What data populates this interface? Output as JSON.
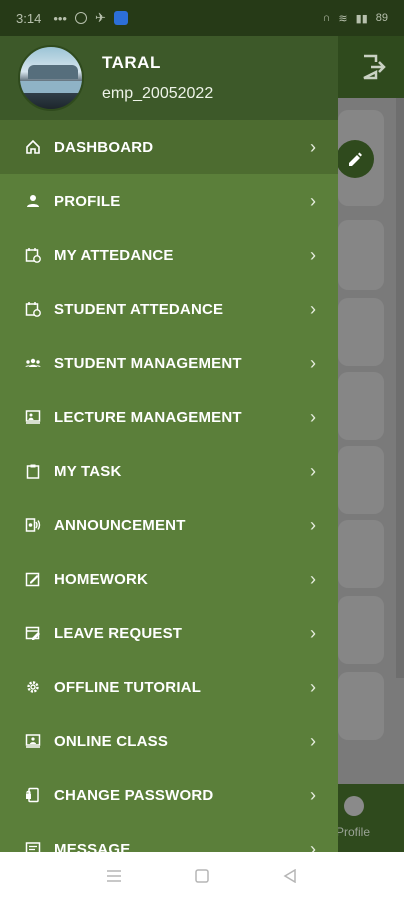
{
  "status": {
    "time": "3:14",
    "right_text": "89"
  },
  "user": {
    "name": "TARAL",
    "id": "emp_20052022"
  },
  "menu": [
    {
      "label": "DASHBOARD",
      "icon": "home-icon",
      "active": true
    },
    {
      "label": "PROFILE",
      "icon": "person-icon"
    },
    {
      "label": "MY ATTEDANCE",
      "icon": "calendar-clock-icon"
    },
    {
      "label": "STUDENT ATTEDANCE",
      "icon": "calendar-clock-icon"
    },
    {
      "label": "STUDENT MANAGEMENT",
      "icon": "group-icon"
    },
    {
      "label": "LECTURE MANAGEMENT",
      "icon": "presentation-icon"
    },
    {
      "label": "MY TASK",
      "icon": "clipboard-icon"
    },
    {
      "label": "ANNOUNCEMENT",
      "icon": "megaphone-icon"
    },
    {
      "label": "HOMEWORK",
      "icon": "edit-box-icon"
    },
    {
      "label": "LEAVE REQUEST",
      "icon": "calendar-edit-icon"
    },
    {
      "label": "OFFLINE TUTORIAL",
      "icon": "gear-icon"
    },
    {
      "label": "ONLINE CLASS",
      "icon": "monitor-person-icon"
    },
    {
      "label": "CHANGE PASSWORD",
      "icon": "phone-lock-icon"
    },
    {
      "label": "MESSAGE",
      "icon": "message-icon"
    }
  ],
  "background": {
    "bottom_nav_label": "Profile"
  },
  "colors": {
    "drawer": "#5b7f3a",
    "drawer_header": "#3d5929",
    "active_item": "#4d6c30",
    "topbar": "#2f4a1d"
  }
}
